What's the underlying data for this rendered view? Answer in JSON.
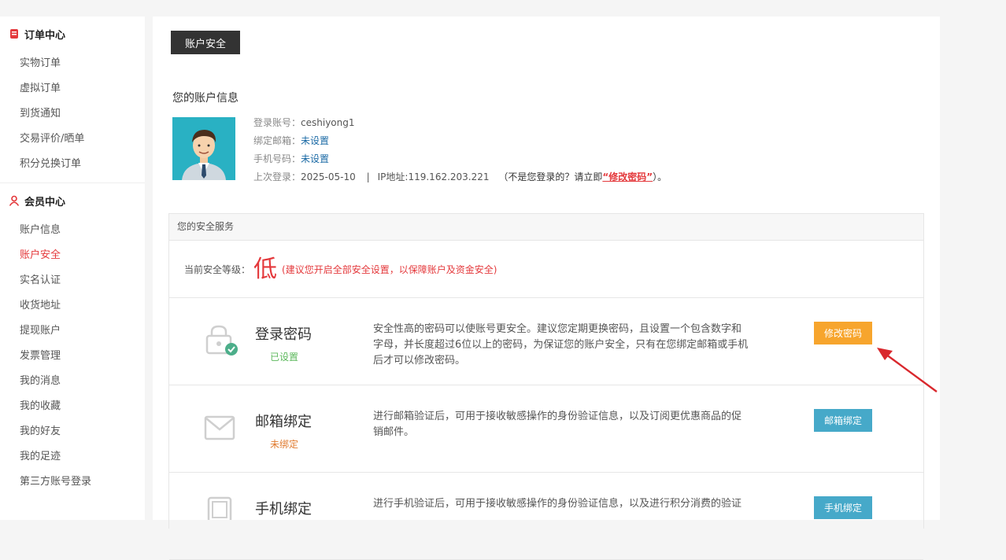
{
  "sidebar": {
    "order_section": {
      "title": "订单中心",
      "items": [
        "实物订单",
        "虚拟订单",
        "到货通知",
        "交易评价/晒单",
        "积分兑换订单"
      ]
    },
    "member_section": {
      "title": "会员中心",
      "items": [
        "账户信息",
        "账户安全",
        "实名认证",
        "收货地址",
        "提现账户",
        "发票管理",
        "我的消息",
        "我的收藏",
        "我的好友",
        "我的足迹",
        "第三方账号登录"
      ],
      "active_index": 1
    }
  },
  "main": {
    "tab_label": "账户安全",
    "account_title": "您的账户信息",
    "info": {
      "login_label": "登录账号：",
      "login_value": "ceshiyong1",
      "email_label": "绑定邮箱：",
      "email_value": "未设置",
      "phone_label": "手机号码：",
      "phone_value": "未设置",
      "last_login_label": "上次登录：",
      "last_login_value": "2025-05-10",
      "separator": "|",
      "ip_text": "IP地址:119.162.203.221",
      "notice_prefix": "（不是您登录的？请立即",
      "notice_link": "“修改密码”",
      "notice_suffix": "）。"
    },
    "services": {
      "header": "您的安全服务",
      "level_label": "当前安全等级：",
      "level_value": "低",
      "level_tip": "(建议您开启全部安全设置，以保障账户及资金安全)",
      "rows": [
        {
          "name": "登录密码",
          "status": "已设置",
          "description": "安全性高的密码可以使账号更安全。建议您定期更换密码，且设置一个包含数字和字母，并长度超过6位以上的密码，为保证您的账户安全，只有在您绑定邮箱或手机后才可以修改密码。",
          "button": "修改密码"
        },
        {
          "name": "邮箱绑定",
          "status": "未绑定",
          "description": "进行邮箱验证后，可用于接收敏感操作的身份验证信息，以及订阅更优惠商品的促销邮件。",
          "button": "邮箱绑定"
        },
        {
          "name": "手机绑定",
          "status": "",
          "description": "进行手机验证后，可用于接收敏感操作的身份验证信息，以及进行积分消费的验证",
          "button": "手机绑定"
        }
      ]
    }
  },
  "colors": {
    "accent_red": "#e4393c",
    "orange_button": "#f7a52d",
    "teal_button": "#46a9c9",
    "status_set": "#5cb85c",
    "status_unset": "#e07a2e"
  }
}
